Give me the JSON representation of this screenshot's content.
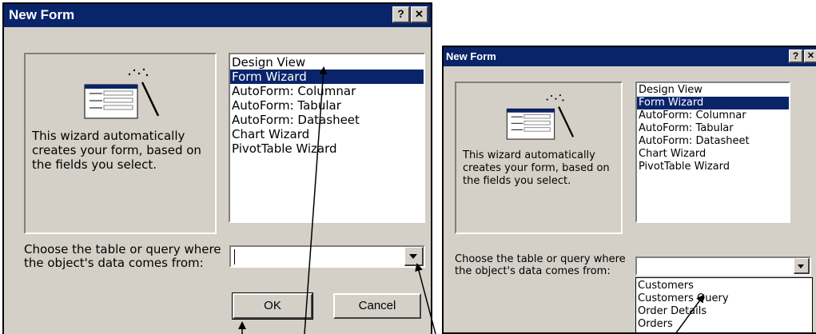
{
  "dialog_large": {
    "title": "New Form",
    "help_label": "?",
    "close_label": "✕",
    "description": "This wizard automatically\ncreates your form, based on\nthe fields you select.",
    "list_items": [
      "Design View",
      "Form Wizard",
      "AutoForm: Columnar",
      "AutoForm: Tabular",
      "AutoForm: Datasheet",
      "Chart Wizard",
      "PivotTable Wizard"
    ],
    "selected_index": 1,
    "choose_label": "Choose the table or query where\nthe object's data comes from:",
    "combo_value": "",
    "ok_label": "OK",
    "cancel_label": "Cancel"
  },
  "dialog_small": {
    "title": "New Form",
    "help_label": "?",
    "close_label": "✕",
    "description": "This wizard automatically\ncreates your form, based on\nthe fields you select.",
    "list_items": [
      "Design View",
      "Form Wizard",
      "AutoForm: Columnar",
      "AutoForm: Tabular",
      "AutoForm: Datasheet",
      "Chart Wizard",
      "PivotTable Wizard"
    ],
    "selected_index": 1,
    "choose_label": "Choose the table or query where\nthe object's data comes from:",
    "combo_value": "",
    "dropdown_options": [
      "Customers",
      "Customers Query",
      "Order Details",
      "Orders"
    ]
  },
  "colors": {
    "title_bar": "#0a246a",
    "face": "#d4d0c8",
    "selection": "#0a246a"
  },
  "icons": [
    "form-wizard-icon",
    "magic-wand-icon",
    "chevron-down-icon",
    "annotation-arrow"
  ]
}
